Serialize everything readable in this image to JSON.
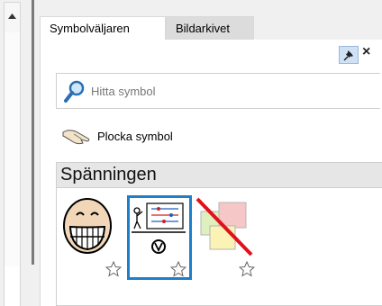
{
  "tabs": [
    {
      "label": "Symbolväljaren",
      "active": true
    },
    {
      "label": "Bildarkivet",
      "active": false
    }
  ],
  "panel": {
    "close_label": "×"
  },
  "search": {
    "placeholder": "Hitta symbol",
    "icon": "search-icon"
  },
  "pick": {
    "label": "Plocka symbol",
    "icon": "pointing-hand-icon"
  },
  "category": {
    "title": "Spänningen",
    "symbols": [
      {
        "name": "laughing-face",
        "favorite": false,
        "selected": false
      },
      {
        "name": "electric-circuit",
        "favorite": false,
        "selected": true
      },
      {
        "name": "no-notes",
        "favorite": false,
        "selected": false
      }
    ]
  },
  "colors": {
    "selection": "#1f7ec9",
    "pin_active": "#cfe1f5"
  }
}
